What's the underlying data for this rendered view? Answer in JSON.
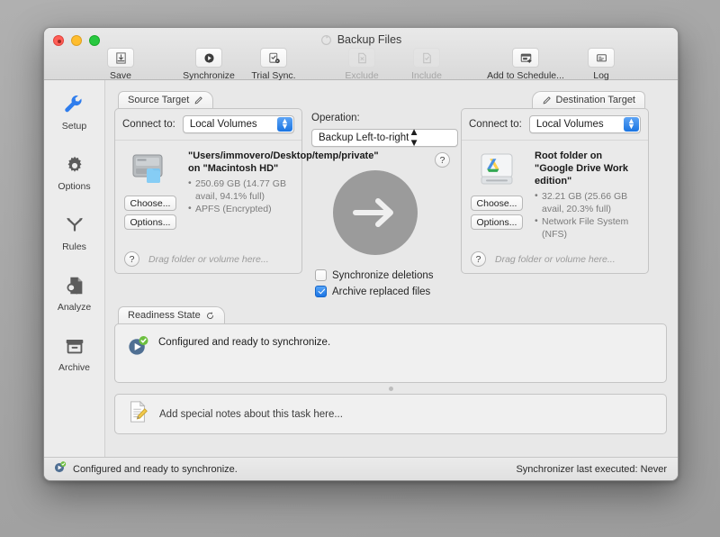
{
  "window": {
    "title": "Backup Files",
    "title_icon": "sync-circle-icon"
  },
  "toolbar": {
    "items": [
      {
        "label": "Save",
        "icon": "save-tray-icon",
        "enabled": true
      },
      {
        "label": "Synchronize",
        "icon": "play-circle-icon",
        "enabled": true
      },
      {
        "label": "Trial Sync.",
        "icon": "clipboard-check-play-icon",
        "enabled": true
      },
      {
        "label": "Exclude",
        "icon": "document-x-icon",
        "enabled": false
      },
      {
        "label": "Include",
        "icon": "document-check-icon",
        "enabled": false
      },
      {
        "label": "Add to Schedule...",
        "icon": "calendar-plus-icon",
        "enabled": true
      },
      {
        "label": "Log",
        "icon": "log-window-icon",
        "enabled": true
      }
    ]
  },
  "sidebar": {
    "items": [
      {
        "label": "Setup",
        "icon": "wrench-icon",
        "selected": true
      },
      {
        "label": "Options",
        "icon": "gear-icon",
        "selected": false
      },
      {
        "label": "Rules",
        "icon": "branch-arrows-icon",
        "selected": false
      },
      {
        "label": "Analyze",
        "icon": "document-search-icon",
        "selected": false
      },
      {
        "label": "Archive",
        "icon": "archive-box-icon",
        "selected": false
      }
    ]
  },
  "source": {
    "tab_label": "Source Target",
    "tab_icon": "pencil-icon",
    "connect_label": "Connect to:",
    "connect_value": "Local Volumes",
    "icon": "hard-disk-folder-icon",
    "title": "\"Users/immovero/Desktop/temp/private\" on \"Macintosh HD\"",
    "details": [
      "250.69 GB (14.77 GB avail, 94.1% full)",
      "APFS (Encrypted)"
    ],
    "choose_label": "Choose...",
    "options_label": "Options...",
    "help_label": "?",
    "drop_hint": "Drag folder or volume here..."
  },
  "destination": {
    "tab_label": "Destination Target",
    "tab_icon": "pencil-icon",
    "connect_label": "Connect to:",
    "connect_value": "Local Volumes",
    "icon": "google-drive-disk-icon",
    "title": "Root folder on \"Google Drive Work edition\"",
    "details": [
      "32.21 GB (25.66 GB avail, 20.3% full)",
      "Network File System (NFS)"
    ],
    "choose_label": "Choose...",
    "options_label": "Options...",
    "help_label": "?",
    "drop_hint": "Drag folder or volume here..."
  },
  "operation": {
    "label": "Operation:",
    "value": "Backup Left-to-right",
    "help_label": "?",
    "direction_icon": "arrow-right-icon",
    "checkboxes": [
      {
        "label": "Synchronize deletions",
        "checked": false
      },
      {
        "label": "Archive replaced files",
        "checked": true
      }
    ]
  },
  "readiness": {
    "tab_label": "Readiness State",
    "tab_icon": "refresh-icon",
    "status_icon": "play-badge-check-icon",
    "status_text": "Configured and ready to synchronize."
  },
  "notes": {
    "icon": "note-pencil-icon",
    "placeholder": "Add special notes about this task here..."
  },
  "statusbar": {
    "icon": "play-badge-check-icon",
    "left_text": "Configured and ready to synchronize.",
    "right_text": "Synchronizer last executed:  Never"
  },
  "colors": {
    "accent": "#1b74e4",
    "selected_sidebar": "#2f7ded",
    "arrow_circle": "#9b9b9b",
    "ready_green": "#6cbf3f"
  }
}
